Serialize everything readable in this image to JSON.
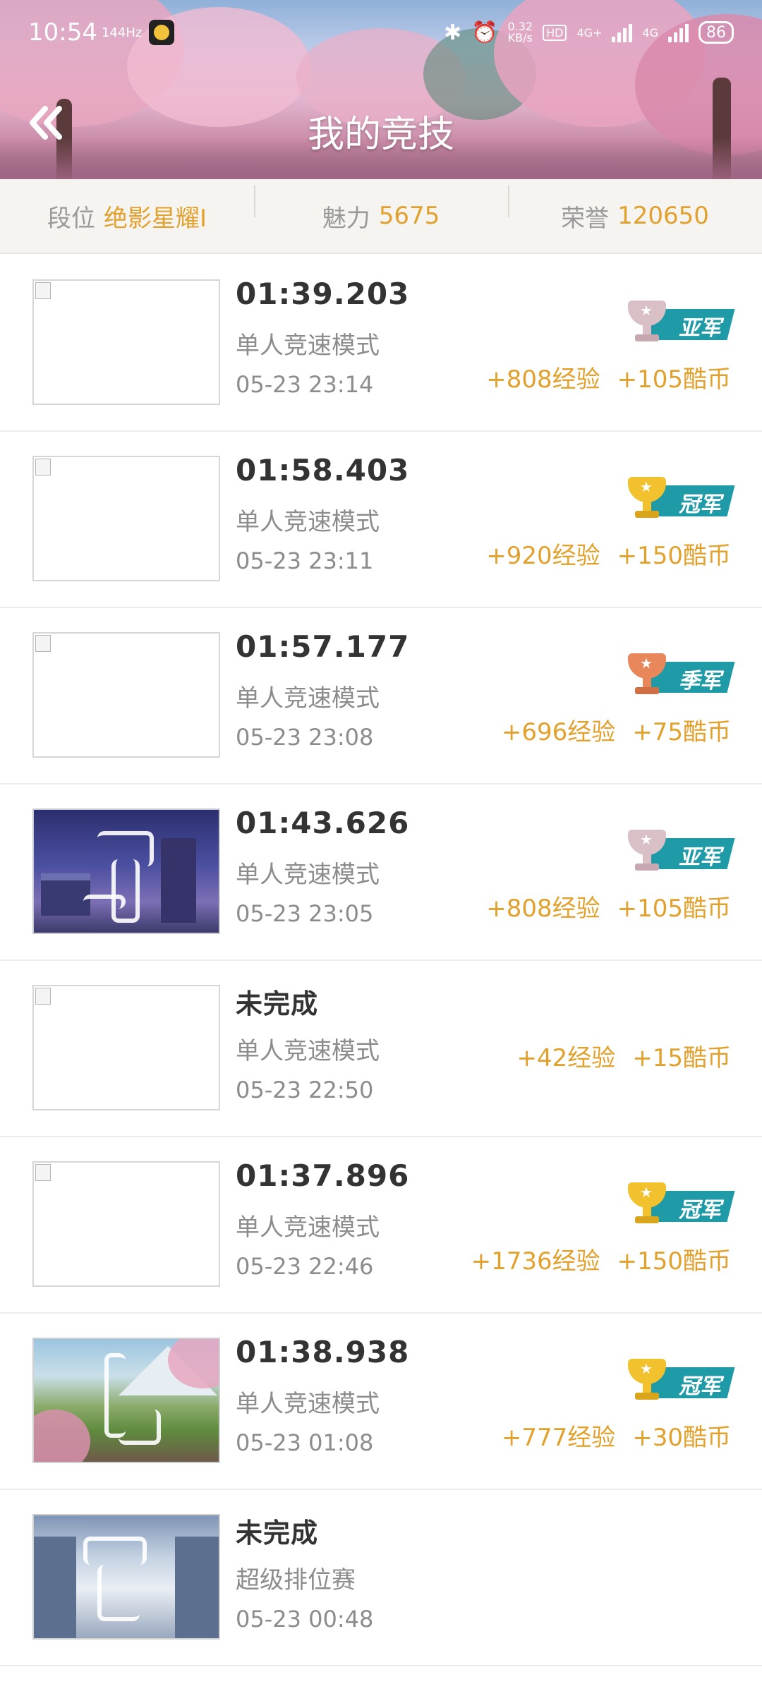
{
  "status_bar": {
    "time": "10:54",
    "refresh": "144Hz",
    "speed_value": "0.32",
    "speed_unit": "KB/s",
    "hd_label": "HD",
    "net1": "4G+",
    "net2": "4G",
    "battery": "86"
  },
  "header": {
    "title": "我的竞技"
  },
  "stats": [
    {
      "label": "段位",
      "value": "绝影星耀I"
    },
    {
      "label": "魅力",
      "value": "5675"
    },
    {
      "label": "荣誉",
      "value": "120650"
    }
  ],
  "records": [
    {
      "result": "01:39.203",
      "mode": "单人竞速模式",
      "date": "05-23 23:14",
      "badge": "亚军",
      "exp": "+808经验",
      "coins": "+105酷币",
      "thumb": "broken"
    },
    {
      "result": "01:58.403",
      "mode": "单人竞速模式",
      "date": "05-23 23:11",
      "badge": "冠军",
      "exp": "+920经验",
      "coins": "+150酷币",
      "thumb": "broken"
    },
    {
      "result": "01:57.177",
      "mode": "单人竞速模式",
      "date": "05-23 23:08",
      "badge": "季军",
      "exp": "+696经验",
      "coins": "+75酷币",
      "thumb": "broken"
    },
    {
      "result": "01:43.626",
      "mode": "单人竞速模式",
      "date": "05-23 23:05",
      "badge": "亚军",
      "exp": "+808经验",
      "coins": "+105酷币",
      "thumb": "night-town"
    },
    {
      "result": "未完成",
      "mode": "单人竞速模式",
      "date": "05-23 22:50",
      "badge": "",
      "exp": "+42经验",
      "coins": "+15酷币",
      "thumb": "broken"
    },
    {
      "result": "01:37.896",
      "mode": "单人竞速模式",
      "date": "05-23 22:46",
      "badge": "冠军",
      "exp": "+1736经验",
      "coins": "+150酷币",
      "thumb": "broken"
    },
    {
      "result": "01:38.938",
      "mode": "单人竞速模式",
      "date": "05-23 01:08",
      "badge": "冠军",
      "exp": "+777经验",
      "coins": "+30酷币",
      "thumb": "mountain-valley"
    },
    {
      "result": "未完成",
      "mode": "超级排位赛",
      "date": "05-23 00:48",
      "badge": "",
      "exp": "",
      "coins": "",
      "thumb": "snow-temple"
    }
  ],
  "colors": {
    "accent": "#e2a12c",
    "ribbon": "#1f9ba8",
    "gold_cup": "#f2c12e",
    "silver_cup": "#d9bfc6",
    "bronze_cup": "#e8875a"
  }
}
